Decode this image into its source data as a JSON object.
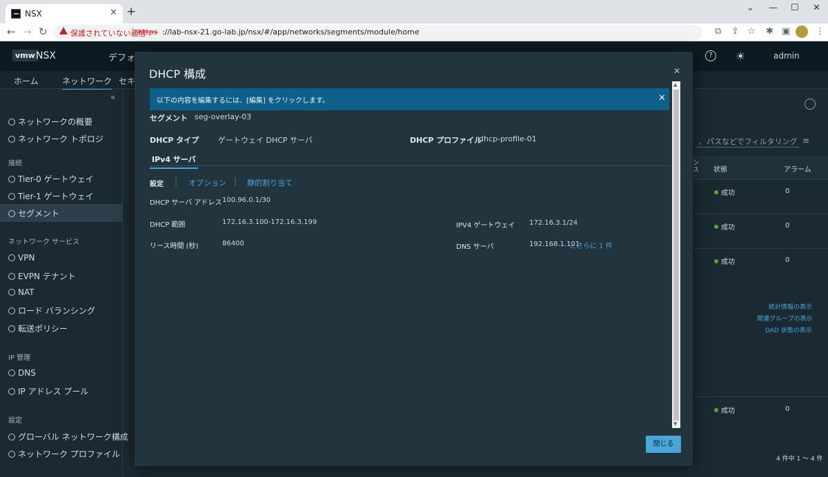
{
  "browser": {
    "tab_title": "NSX",
    "security_warning": "保護されていない通信",
    "url_scheme": "https",
    "url_rest": "://lab-nsx-21.go-lab.jp/nsx/#/app/networks/segments/module/home"
  },
  "app": {
    "logo": "vmw",
    "product": "NSX",
    "environment": "デフォル",
    "user": "admin",
    "tabs": [
      "ホーム",
      "ネットワーク",
      "セキ"
    ]
  },
  "sidebar": {
    "items": [
      {
        "label": "ネットワークの概要"
      },
      {
        "label": "ネットワーク トポロジ"
      },
      {
        "label": "Tier-0 ゲートウェイ"
      },
      {
        "label": "Tier-1 ゲートウェイ"
      },
      {
        "label": "セグメント"
      },
      {
        "label": "VPN"
      },
      {
        "label": "EVPN テナント"
      },
      {
        "label": "NAT"
      },
      {
        "label": "ロード バランシング"
      },
      {
        "label": "転送ポリシー"
      },
      {
        "label": "DNS"
      },
      {
        "label": "IP アドレス プール"
      },
      {
        "label": "グローバル ネットワーク構成"
      },
      {
        "label": "ネットワーク プロファイル"
      }
    ],
    "sections": [
      "接続",
      "ネットワーク サービス",
      "IP 管理",
      "設定"
    ]
  },
  "background": {
    "filter_placeholder": "、パスなどでフィルタリング",
    "col_status": "状態",
    "col_alarm": "アラーム",
    "col_partial": "ン\nス",
    "status_value": "成功",
    "alarm_value": "0",
    "links": [
      "統計情報の表示",
      "関連グループの表示",
      "DAD 状態の表示"
    ],
    "footer": "4 件中 1 ～ 4 件"
  },
  "modal": {
    "title": "DHCP 構成",
    "info_banner": "以下の内容を編集するには、[編集] をクリックします。",
    "segment_label": "セグメント",
    "segment_value": "seg-overlay-03",
    "dhcp_type_label": "DHCP タイプ",
    "dhcp_type_value": "ゲートウェイ DHCP サーバ",
    "dhcp_profile_label": "DHCP プロファイル",
    "dhcp_profile_value": "dhcp-profile-01",
    "subtab": "IPv4 サーバ",
    "links": {
      "settings": "設定",
      "options": "オプション",
      "static": "静的割り当て"
    },
    "server_address_label": "DHCP サーバ アドレス",
    "server_address_value": "100.96.0.1/30",
    "range_label": "DHCP 範囲",
    "range_value": "172.16.3.100-172.16.3.199",
    "lease_label": "リース時間 (秒)",
    "lease_value": "86400",
    "gateway_label": "IPV4 ゲートウェイ",
    "gateway_value": "172.16.3.1/24",
    "dns_label": "DNS サーバ",
    "dns_value": "192.168.1.101",
    "dns_more": "とさらに 1 件",
    "close_button": "閉じる"
  }
}
